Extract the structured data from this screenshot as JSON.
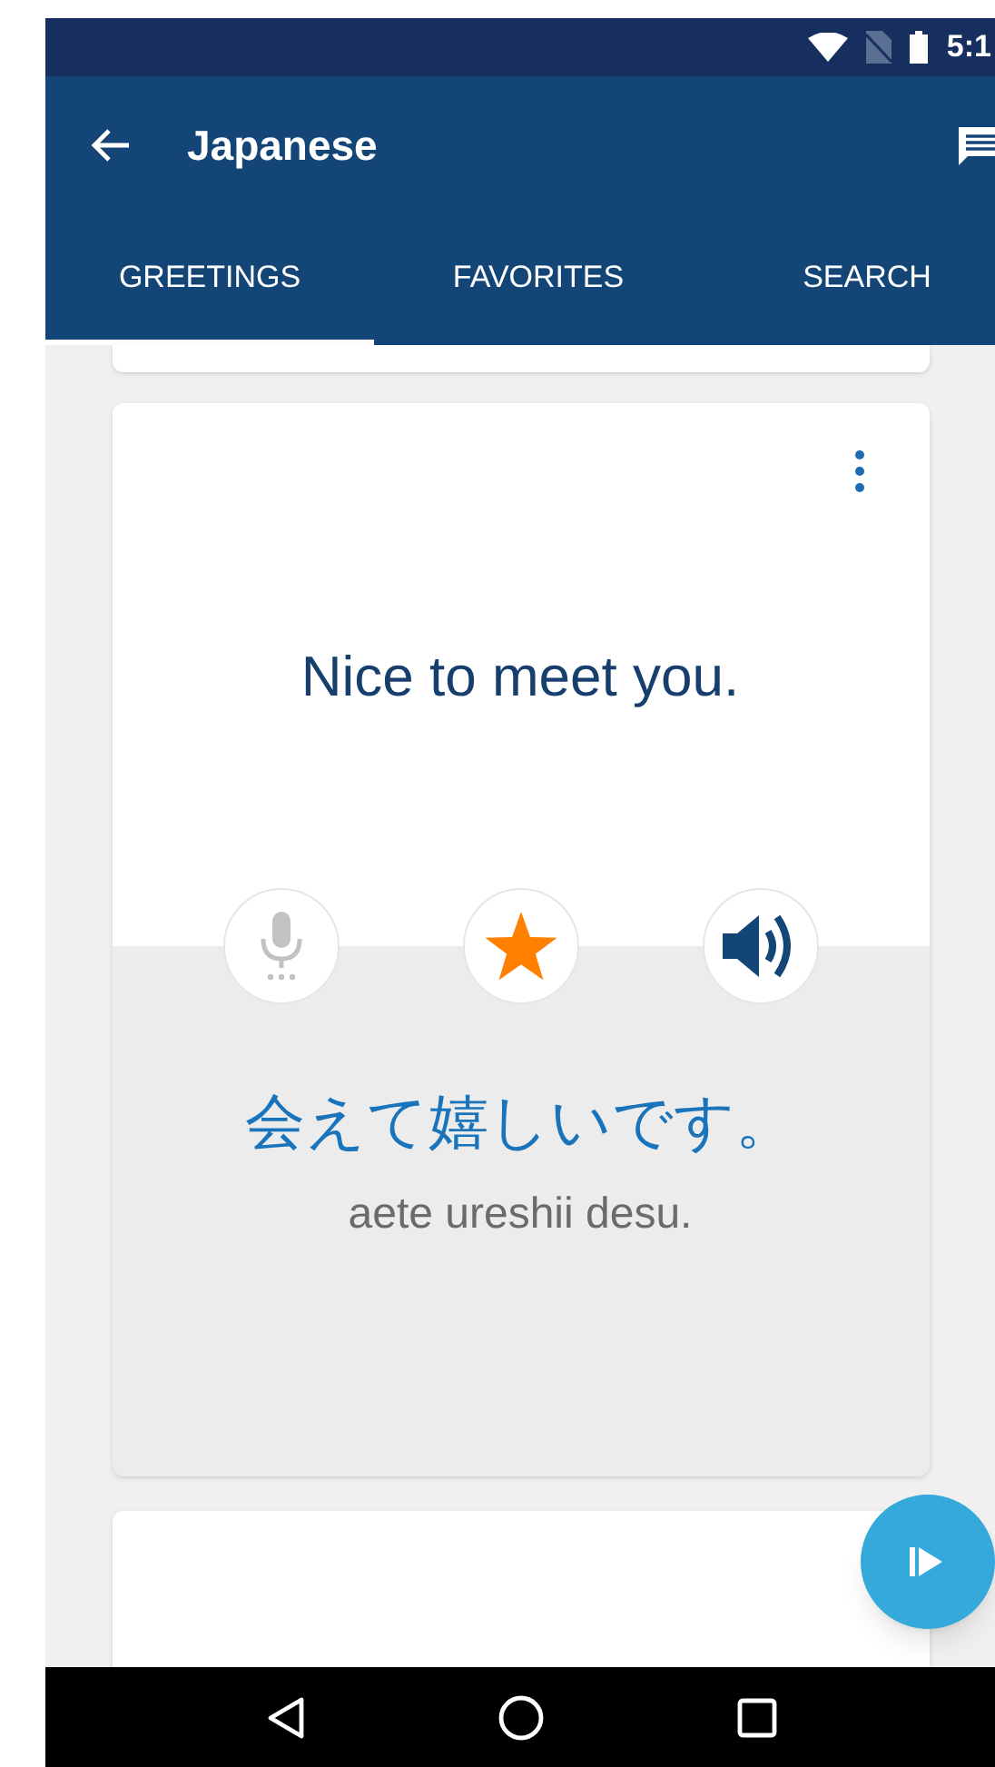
{
  "status_bar": {
    "time": "5:1"
  },
  "app_bar": {
    "title": "Japanese"
  },
  "tabs": [
    {
      "label": "GREETINGS",
      "selected": true
    },
    {
      "label": "FAVORITES",
      "selected": false
    },
    {
      "label": "SEARCH",
      "selected": false
    }
  ],
  "card": {
    "phrase": "Nice to meet you.",
    "microphone_disabled": true,
    "favorite": true,
    "translation": "会えて嬉しいです。",
    "romanization": "aete ureshii desu."
  }
}
